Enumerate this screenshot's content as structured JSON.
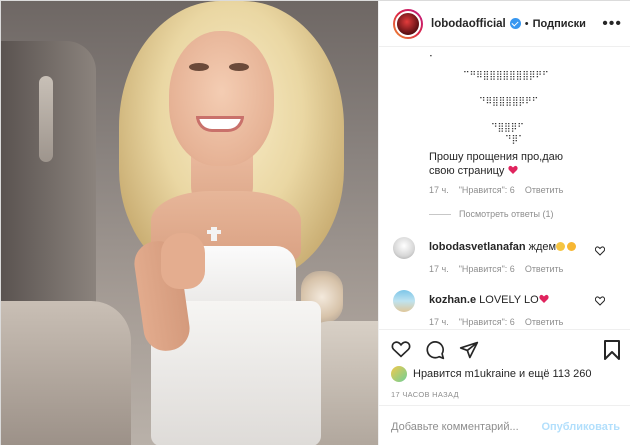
{
  "header": {
    "username": "lobodaofficial",
    "separator": "•",
    "follow_label": "Подписки",
    "more": "•••"
  },
  "comments": {
    "art_lines": [
      "⠁",
      "⠉⠛⠿⣿⣿⣿⣿⣿⣿⣿⡿⠟⠋",
      "⠙⠿⣿⣿⣿⣿⡿⠟⠋",
      "⠙⣿⣿⡿⠋",
      "⠙⡿⠁"
    ],
    "first_text_line1": "Прошу прощения про,даю",
    "first_text_line2": "свою страницу",
    "first_meta": {
      "time": "17 ч.",
      "likes": "\"Нравится\": 6",
      "reply": "Ответить"
    },
    "view_replies": "Посмотреть ответы (1)",
    "second": {
      "user": "lobodasvetlanafan",
      "text": "ждем",
      "time": "17 ч.",
      "likes": "\"Нравится\": 6",
      "reply": "Ответить"
    },
    "third": {
      "user": "kozhan.e",
      "text": "LOVELY LO",
      "time": "17 ч.",
      "likes": "\"Нравится\": 6",
      "reply": "Ответить"
    }
  },
  "actions": {
    "likes_text": "Нравится m1ukraine и ещё 113 260",
    "time_ago": "17 часов назад",
    "comment_placeholder": "Добавьте комментарий...",
    "publish_label": "Опубликовать"
  }
}
